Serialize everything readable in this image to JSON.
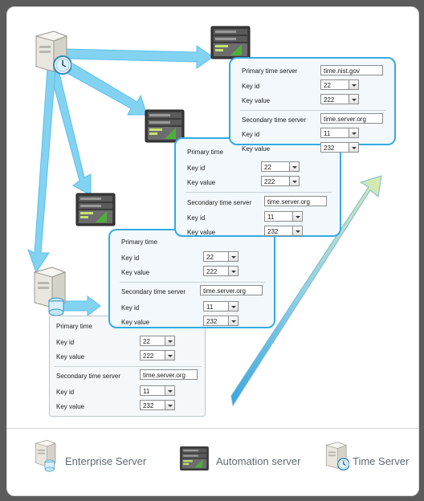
{
  "diagram": {
    "title": "Time server configuration propagation diagram",
    "accent_color": "#36a9e1",
    "panel_bg": "#f2f8fb",
    "arrow_blue": "#7fd0f2",
    "arrow_green": "#c9e5a0"
  },
  "panels": [
    {
      "id": "panel-time-server",
      "labels": {
        "primary_time_server": "Primary time server",
        "key_id": "Key id",
        "key_value": "Key value",
        "secondary_time_server": "Secondary time server",
        "secondary_key_id": "Key id",
        "secondary_key_value": "Key value"
      },
      "values": {
        "primary_time_server": "time.nist.gov",
        "key_id": "22",
        "key_value": "222",
        "secondary_time_server": "time.server.org",
        "secondary_key_id": "11",
        "secondary_key_value": "232"
      }
    },
    {
      "id": "panel-automation-1",
      "labels": {
        "primary_time_server": "Primary time",
        "key_id": "Key id",
        "key_value": "Key value",
        "secondary_time_server": "Secondary time server",
        "secondary_key_id": "Key id",
        "secondary_key_value": "Key value"
      },
      "values": {
        "key_id": "22",
        "key_value": "222",
        "secondary_time_server": "time.server.org",
        "secondary_key_id": "11",
        "secondary_key_value": "232"
      }
    },
    {
      "id": "panel-automation-2",
      "labels": {
        "primary_time_server": "Primary time",
        "key_id": "Key id",
        "key_value": "Key value",
        "secondary_time_server": "Secondary time server",
        "secondary_key_id": "Key id",
        "secondary_key_value": "Key value"
      },
      "values": {
        "key_id": "22",
        "key_value": "222",
        "secondary_time_server": "time.server.org",
        "secondary_key_id": "11",
        "secondary_key_value": "232"
      }
    },
    {
      "id": "panel-enterprise",
      "labels": {
        "primary_time_server": "Primary time",
        "key_id": "Key id",
        "key_value": "Key value",
        "secondary_time_server": "Secondary time server",
        "secondary_key_id": "Key id",
        "secondary_key_value": "Key value"
      },
      "values": {
        "key_id": "22",
        "key_value": "222",
        "secondary_time_server": "time.server.org",
        "secondary_key_id": "11",
        "secondary_key_value": "232"
      }
    }
  ],
  "legend": [
    {
      "icon": "enterprise-server-icon",
      "label": "Enterprise Server"
    },
    {
      "icon": "automation-server-icon",
      "label": "Automation server"
    },
    {
      "icon": "time-server-icon",
      "label": "Time Server"
    }
  ]
}
